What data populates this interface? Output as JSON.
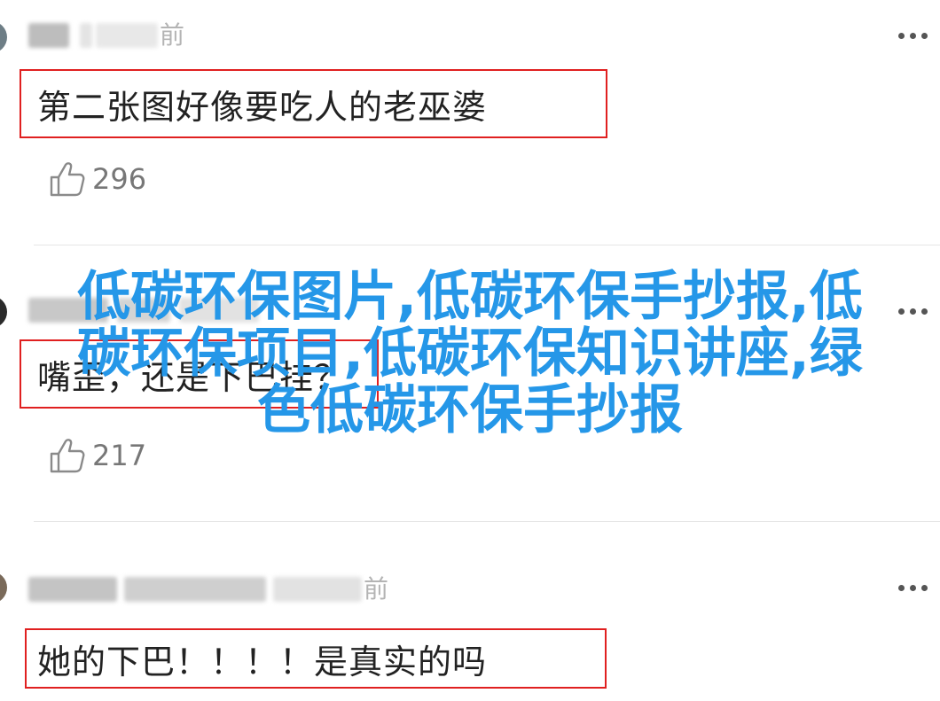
{
  "comments": [
    {
      "time_suffix": "前",
      "text": "第二张图好像要吃人的老巫婆",
      "likes": "296"
    },
    {
      "time_suffix": "",
      "text": "嘴歪，还是下巴挂？",
      "likes": "217"
    },
    {
      "time_suffix": "前",
      "text": "她的下巴！！！！是真实的吗",
      "likes": ""
    }
  ],
  "overlay": {
    "line1": "低碳环保图片,低碳环保手抄报,低",
    "line2": "碳环保项目,低碳环保知识讲座,绿",
    "line3": "色低碳环保手抄报"
  },
  "icons": {
    "like": "thumbs-up-icon",
    "more": "more-dots-icon"
  },
  "colors": {
    "highlight_border": "#e02020",
    "overlay_text": "#2597e8",
    "meta_text": "#777777"
  }
}
